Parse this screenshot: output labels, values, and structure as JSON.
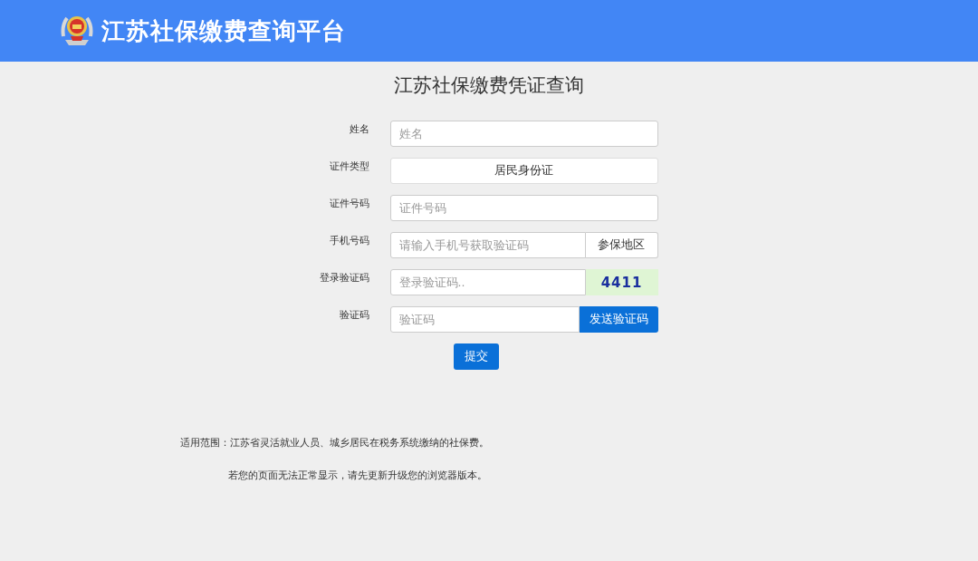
{
  "header": {
    "title": "江苏社保缴费查询平台"
  },
  "page_title": "江苏社保缴费凭证查询",
  "form": [
    {
      "kind": "text",
      "label": "姓名",
      "placeholder": "姓名"
    },
    {
      "kind": "select",
      "label": "证件类型",
      "value": "居民身份证"
    },
    {
      "kind": "text",
      "label": "证件号码",
      "placeholder": "证件号码"
    },
    {
      "kind": "addon",
      "label": "手机号码",
      "placeholder": "请输入手机号获取验证码",
      "addon": "参保地区"
    },
    {
      "kind": "captcha",
      "label": "登录验证码",
      "placeholder": "登录验证码..",
      "code": "4411"
    },
    {
      "kind": "button",
      "label": "验证码",
      "placeholder": "验证码",
      "button": "发送验证码"
    }
  ],
  "submit": "提交",
  "notes": [
    "适用范围：江苏省灵活就业人员、城乡居民在税务系统缴纳的社保费。",
    "若您的页面无法正常显示，请先更新升级您的浏览器版本。"
  ]
}
